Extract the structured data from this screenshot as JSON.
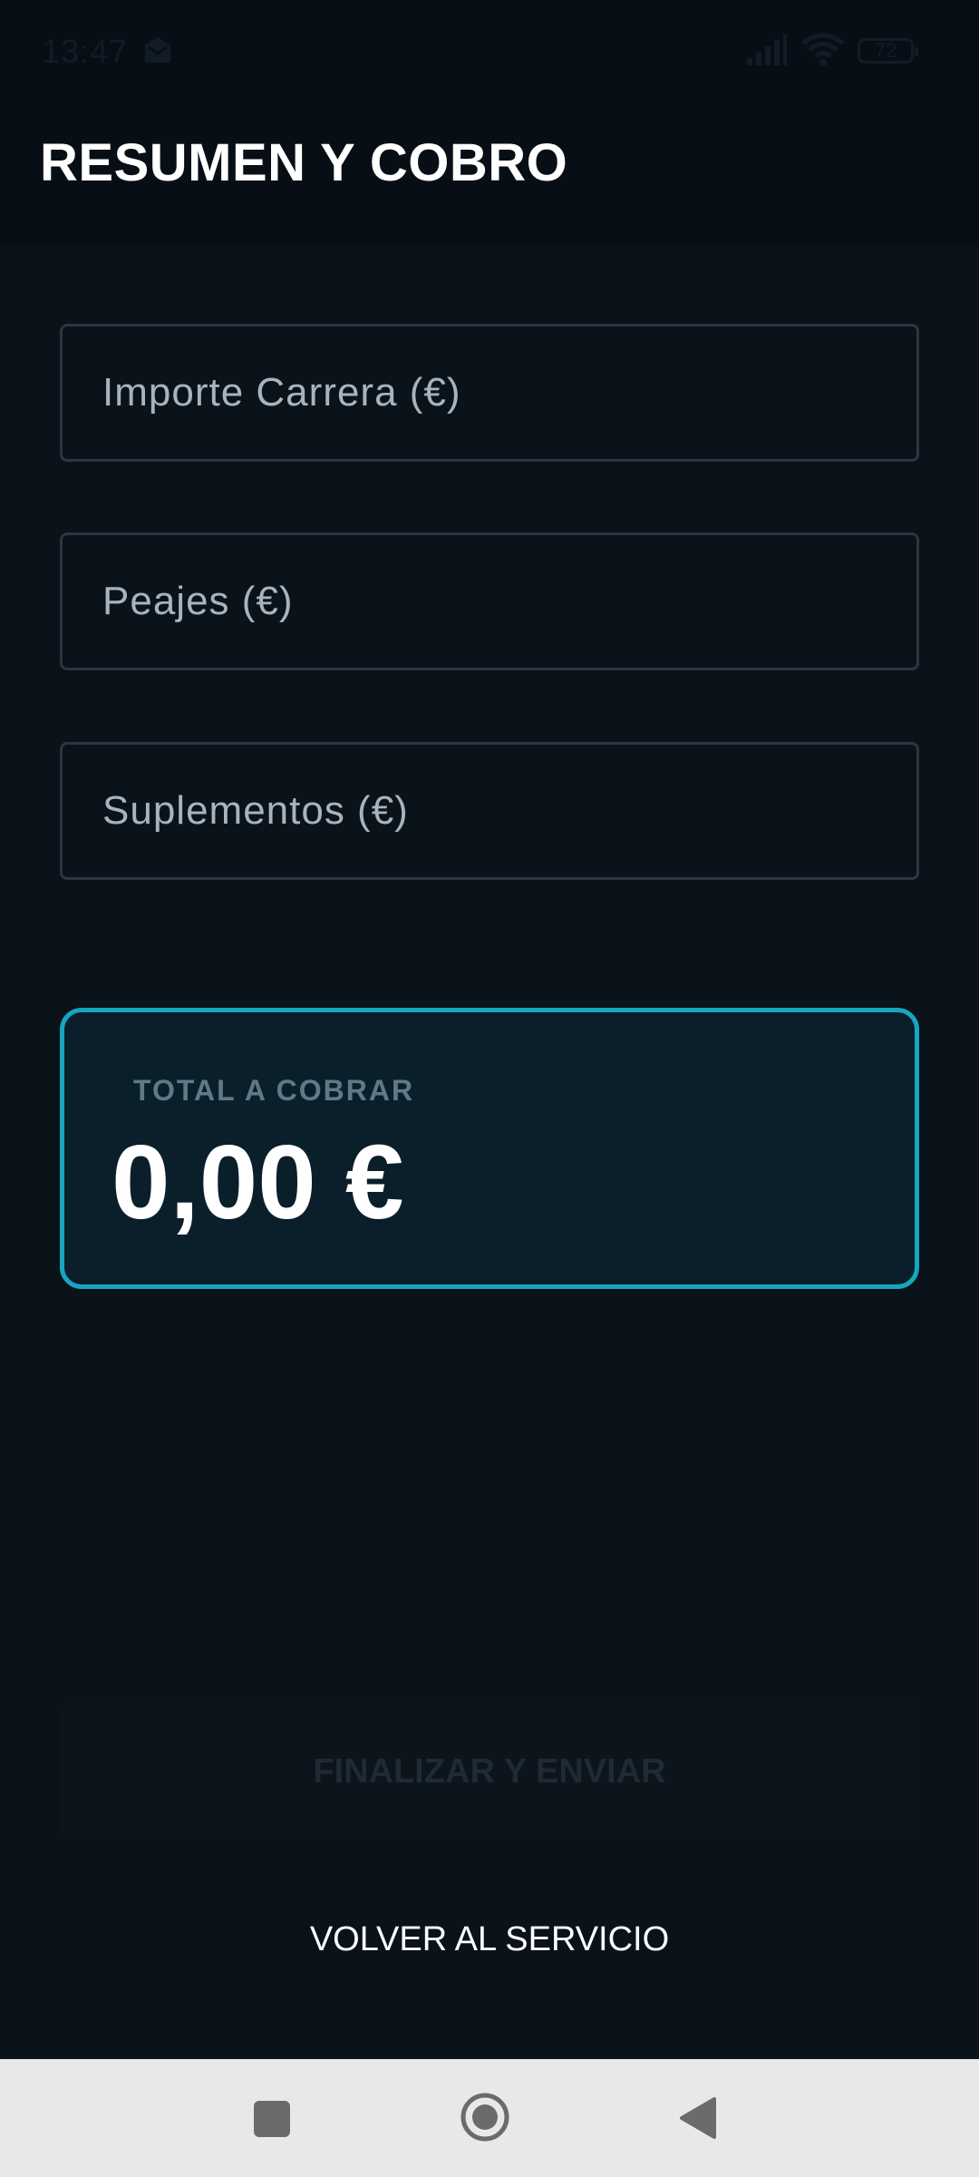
{
  "status_bar": {
    "time": "13:47",
    "battery": "72"
  },
  "header": {
    "title": "RESUMEN Y COBRO"
  },
  "form": {
    "fields": [
      {
        "placeholder": "Importe Carrera (€)",
        "value": ""
      },
      {
        "placeholder": "Peajes (€)",
        "value": ""
      },
      {
        "placeholder": "Suplementos (€)",
        "value": ""
      }
    ]
  },
  "total": {
    "label": "TOTAL A COBRAR",
    "value": "0,00 €"
  },
  "actions": {
    "finalize_label": "FINALIZAR Y ENVIAR",
    "back_label": "VOLVER AL SERVICIO"
  },
  "icons": {
    "status": [
      "notification-icon",
      "signal-icon",
      "wifi-icon",
      "battery-icon"
    ],
    "nav": [
      "recents-icon",
      "home-icon",
      "back-icon"
    ]
  },
  "colors": {
    "background": "#0a121a",
    "accent": "#17a6bf",
    "card_background": "#0b1f2b",
    "text_primary": "#ffffff",
    "text_muted": "#a7b4bd"
  }
}
